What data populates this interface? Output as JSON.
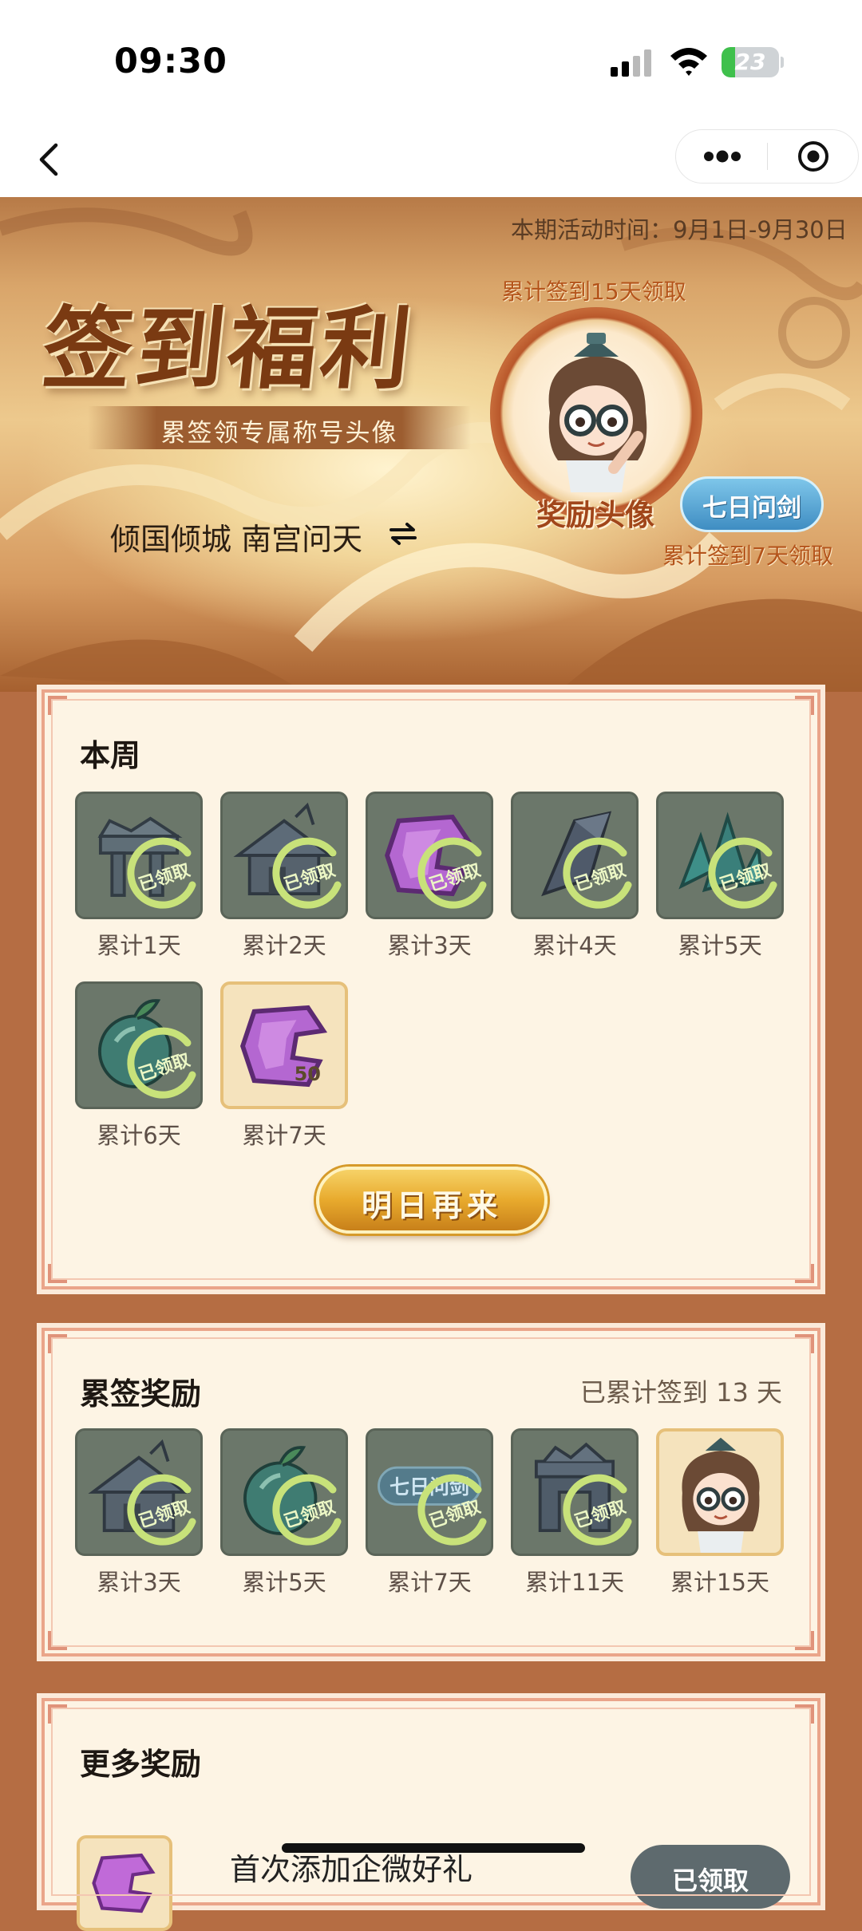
{
  "status_bar": {
    "time": "09:30",
    "battery_level": 0.23,
    "battery_text": "23",
    "icons": [
      "signal-icon",
      "wifi-icon",
      "battery-icon"
    ]
  },
  "nav": {
    "icons": [
      "back-arrow-icon",
      "more-dots-icon",
      "close-target-icon"
    ]
  },
  "banner": {
    "activity_time": "本期活动时间：9月1日-9月30日",
    "title": "签到福利",
    "subtitle": "累签领专属称号头像",
    "user_name": "倾国倾城 南宫问天",
    "label_15": "累计签到15天领取",
    "avatar_label": "奖励头像",
    "badge": "七日问剑",
    "label_7": "累计签到7天领取"
  },
  "week": {
    "title": "本周",
    "stamp_text": "已领取",
    "items": [
      {
        "label": "累计1天",
        "state": "claimed",
        "icon": "broken-pillar-icon"
      },
      {
        "label": "累计2天",
        "state": "claimed",
        "icon": "broken-house-icon"
      },
      {
        "label": "累计3天",
        "state": "claimed",
        "icon": "purple-gem-icon"
      },
      {
        "label": "累计4天",
        "state": "claimed",
        "icon": "blade-shard-icon"
      },
      {
        "label": "累计5天",
        "state": "claimed",
        "icon": "green-crystal-icon"
      },
      {
        "label": "累计6天",
        "state": "claimed",
        "icon": "green-fruit-icon"
      },
      {
        "label": "累计7天",
        "state": "active",
        "icon": "purple-gem-icon",
        "qty": "50"
      }
    ],
    "button": "明日再来"
  },
  "cumulative": {
    "title": "累签奖励",
    "summary": "已累计签到 13 天",
    "stamp_text": "已领取",
    "badge_ghost": "七日问剑",
    "items": [
      {
        "label": "累计3天",
        "state": "claimed",
        "icon": "broken-house-icon"
      },
      {
        "label": "累计5天",
        "state": "claimed",
        "icon": "green-fruit-icon"
      },
      {
        "label": "累计7天",
        "state": "claimed",
        "icon": "title-badge-icon"
      },
      {
        "label": "累计11天",
        "state": "claimed",
        "icon": "broken-gate-icon"
      },
      {
        "label": "累计15天",
        "state": "active",
        "icon": "avatar-portrait-icon"
      }
    ]
  },
  "more": {
    "title": "更多奖励",
    "item_title": "首次添加企微好礼",
    "item_button": "已领取"
  },
  "colors": {
    "page_bg": "#b56d43",
    "card_bg": "#fdf4e4",
    "card_border": "#eaa58a",
    "claimed_tile": "#6b776a",
    "stamp": "#c8e27a",
    "button_gold": "#e8aa2d",
    "badge_blue": "#3f8dc2",
    "battery_green": "#3fc04c"
  }
}
